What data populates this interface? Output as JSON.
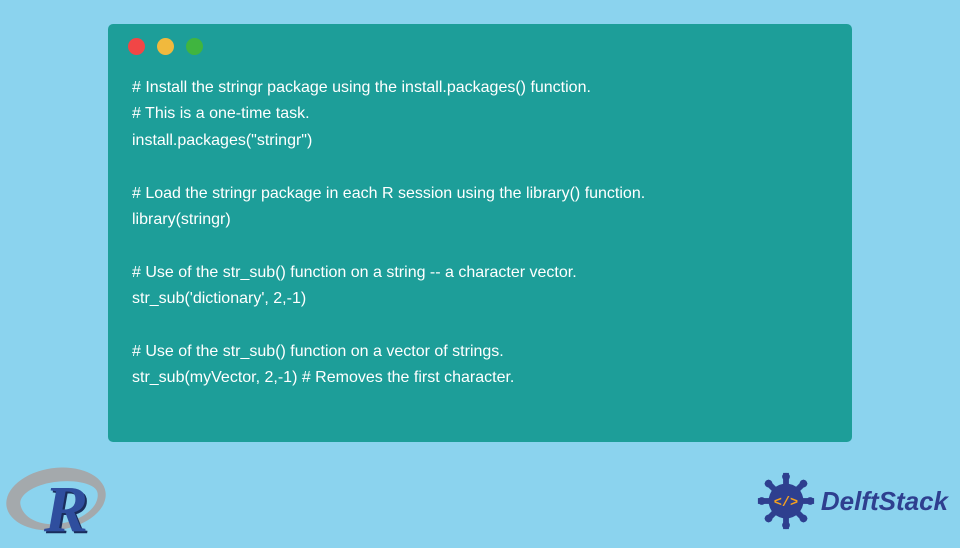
{
  "code": {
    "lines": [
      "# Install the stringr package using the install.packages() function.",
      "# This is a one-time task.",
      "install.packages(\"stringr\")",
      "",
      "# Load the stringr package in each R session using the library() function.",
      "library(stringr)",
      "",
      "# Use of the str_sub() function on a string -- a character vector.",
      "str_sub('dictionary', 2,-1)",
      "",
      "# Use of the str_sub() function on a vector of strings.",
      "str_sub(myVector, 2,-1) # Removes the first character."
    ]
  },
  "r_logo": {
    "letter": "R"
  },
  "delft": {
    "text": "DelftStack",
    "code_symbol": "</>"
  }
}
